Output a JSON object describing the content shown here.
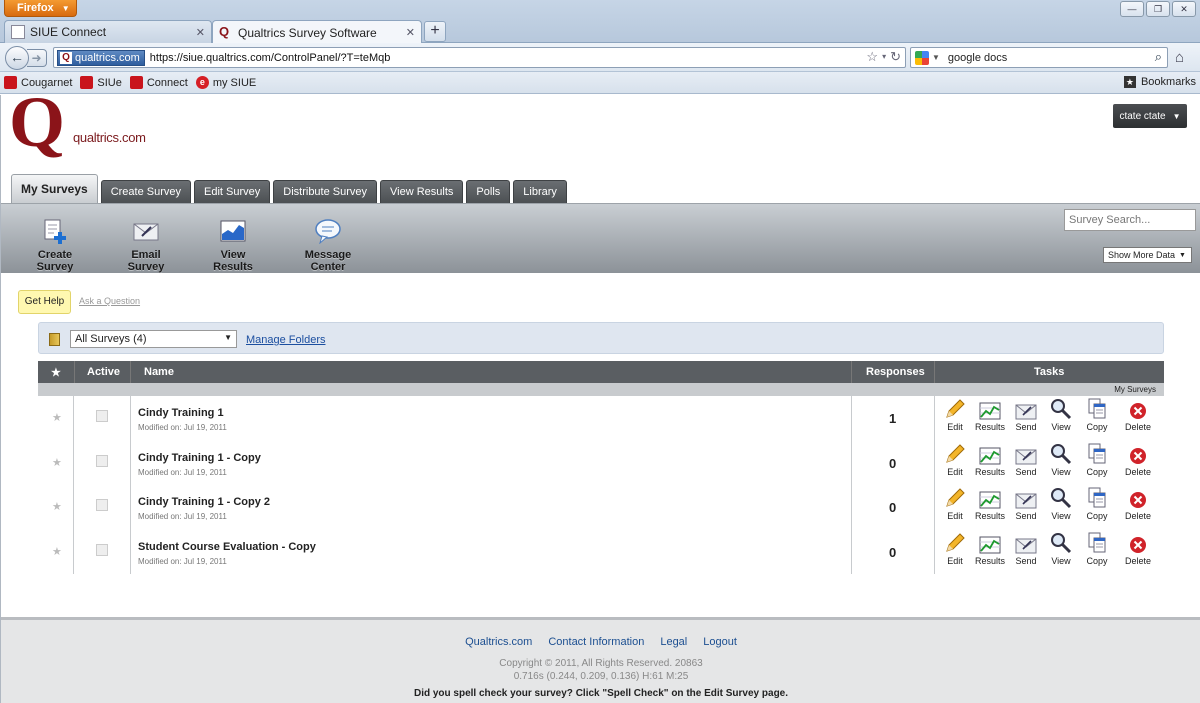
{
  "browser": {
    "menu_label": "Firefox",
    "tabs": [
      {
        "title": "SIUE Connect"
      },
      {
        "title": "Qualtrics Survey Software"
      }
    ],
    "new_tab_label": "+",
    "site_identity": "qualtrics.com",
    "url": "https://siue.qualtrics.com/ControlPanel/?T=teMqb",
    "search_value": "google docs",
    "bookmarks": [
      {
        "label": "Cougarnet"
      },
      {
        "label": "SIUe"
      },
      {
        "label": "Connect"
      },
      {
        "label": "my SIUE"
      }
    ],
    "bookmarks_menu": "Bookmarks"
  },
  "header": {
    "brand": "qualtrics.com",
    "user_label": "ctate ctate"
  },
  "main_tabs": [
    {
      "label": "My Surveys"
    },
    {
      "label": "Create Survey"
    },
    {
      "label": "Edit Survey"
    },
    {
      "label": "Distribute Survey"
    },
    {
      "label": "View Results"
    },
    {
      "label": "Polls"
    },
    {
      "label": "Library"
    }
  ],
  "toolbar": {
    "items": [
      {
        "label": "Create Survey",
        "icon": "create-survey-icon"
      },
      {
        "label": "Email Survey",
        "icon": "email-survey-icon"
      },
      {
        "label": "View Results",
        "icon": "view-results-icon"
      },
      {
        "label": "Message Center",
        "icon": "message-center-icon"
      }
    ],
    "search_placeholder": "Survey Search...",
    "show_more": "Show More Data"
  },
  "help": {
    "get_help": "Get Help",
    "ask_question": "Ask a Question"
  },
  "folder": {
    "selected": "All Surveys (4)",
    "manage_folders": "Manage Folders"
  },
  "table": {
    "columns": {
      "star": "★",
      "active": "Active",
      "name": "Name",
      "responses": "Responses",
      "tasks": "Tasks"
    },
    "folder_label": "My Surveys",
    "task_labels": [
      "Edit",
      "Results",
      "Send",
      "View",
      "Copy",
      "Delete"
    ],
    "rows": [
      {
        "name": "Cindy Training 1",
        "modified": "Modified on: Jul 19, 2011",
        "responses": "1"
      },
      {
        "name": "Cindy Training 1 - Copy",
        "modified": "Modified on: Jul 19, 2011",
        "responses": "0"
      },
      {
        "name": "Cindy Training 1 - Copy 2",
        "modified": "Modified on: Jul 19, 2011",
        "responses": "0"
      },
      {
        "name": "Student Course Evaluation - Copy",
        "modified": "Modified on: Jul 19, 2011",
        "responses": "0"
      }
    ]
  },
  "footer": {
    "links": [
      "Qualtrics.com",
      "Contact Information",
      "Legal",
      "Logout"
    ],
    "copyright": "Copyright © 2011, All Rights Reserved. 20863",
    "timing": "0.716s (0.244, 0.209, 0.136) H:61 M:25",
    "tip": "Did you spell check your survey? Click \"Spell Check\" on the Edit Survey page."
  },
  "colors": {
    "brand": "#8b1419",
    "toolbar_dark": "#5a5e62",
    "link": "#1c4fa0",
    "delete": "#d0232a"
  }
}
